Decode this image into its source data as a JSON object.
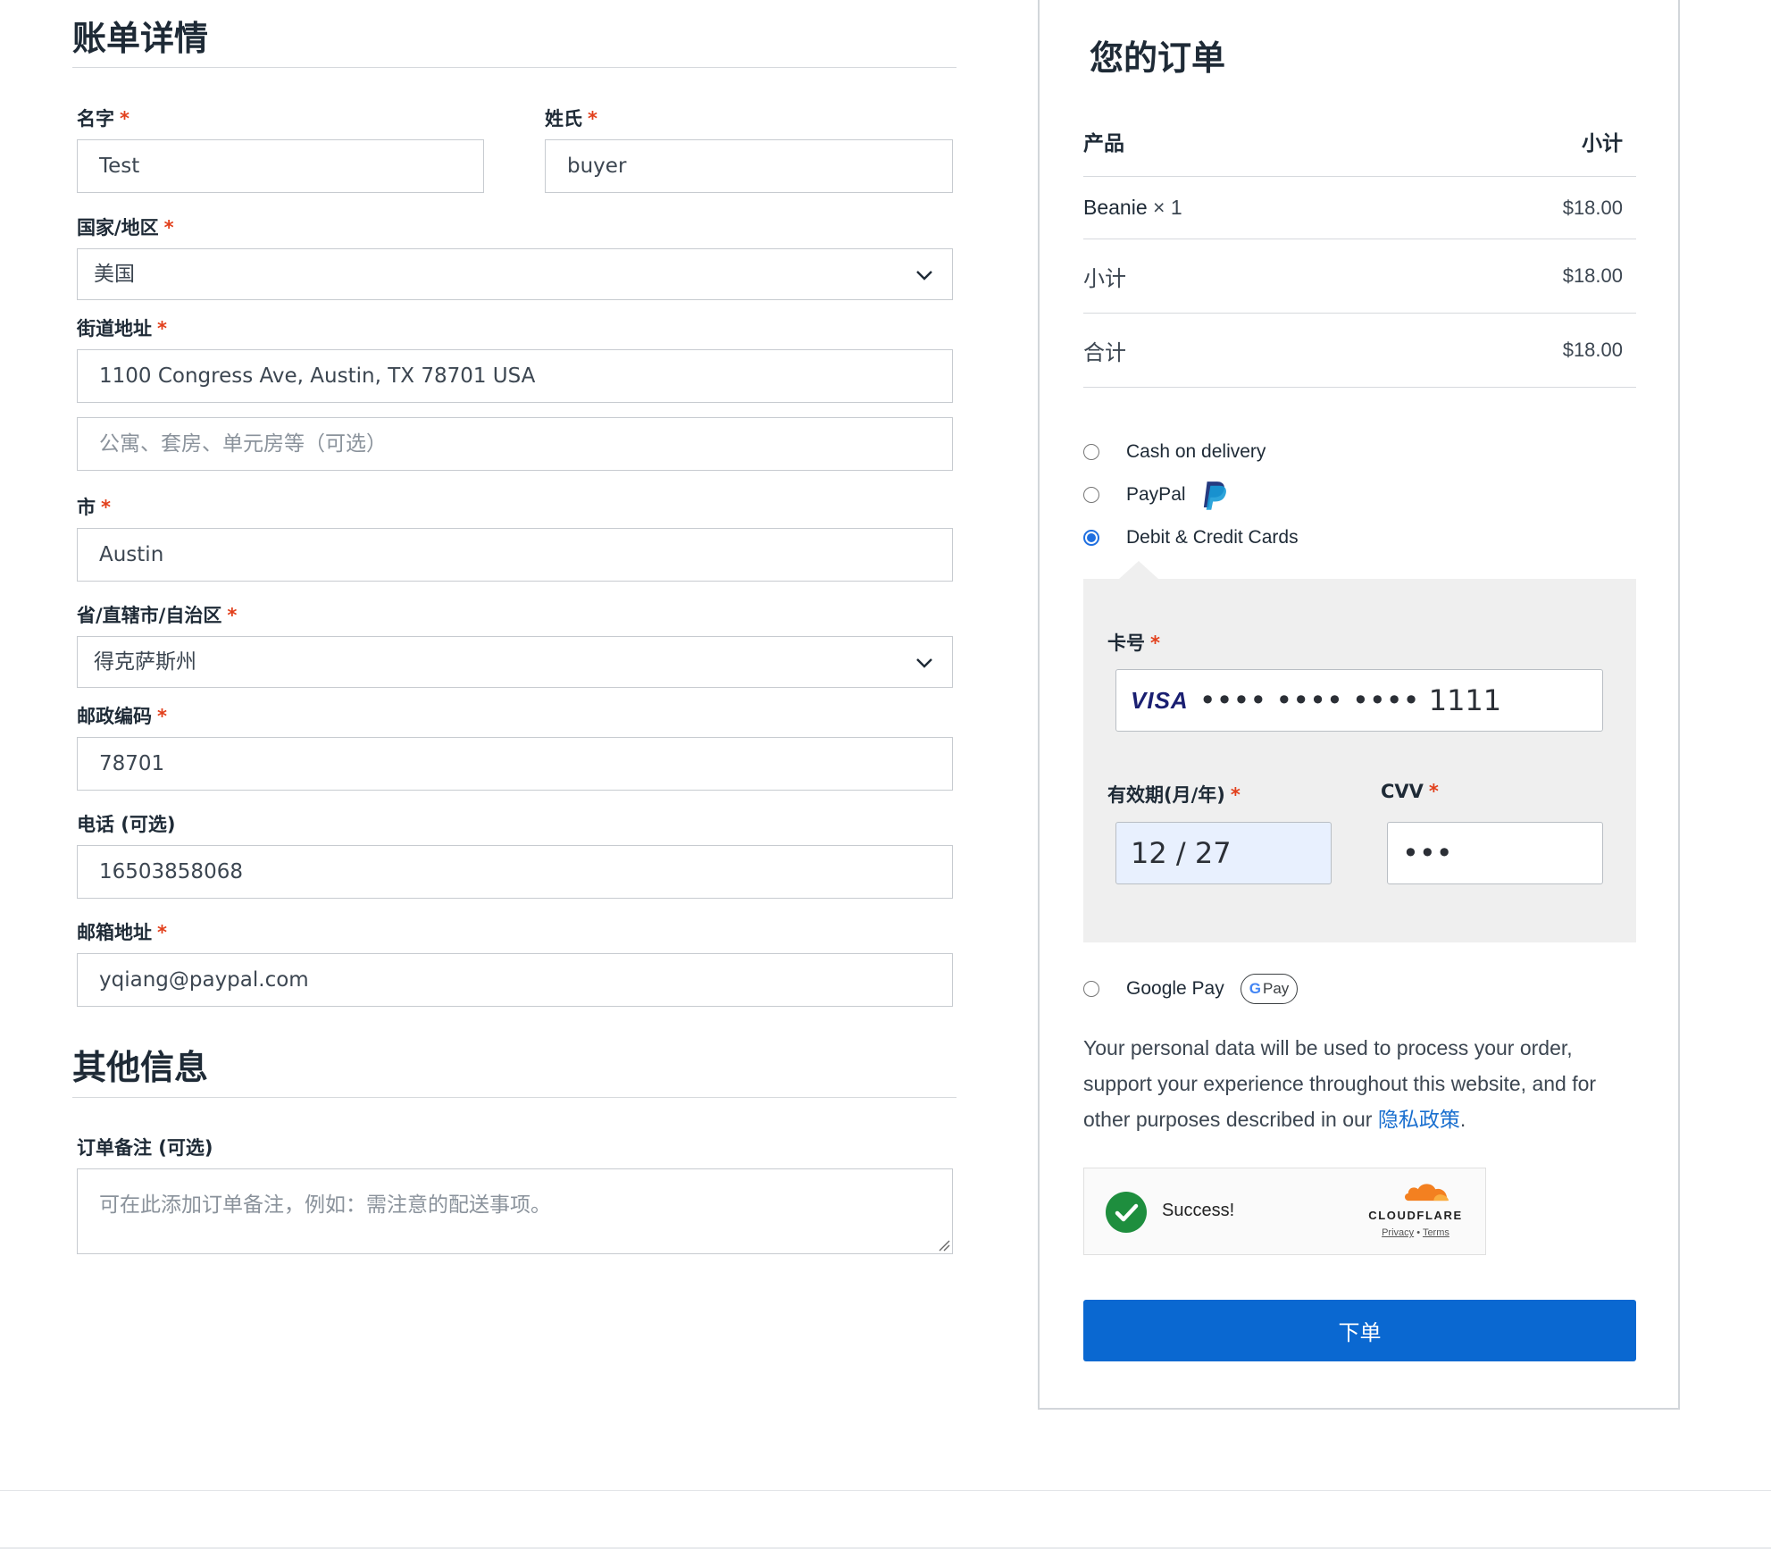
{
  "billing": {
    "title": "账单详情",
    "first_name": {
      "label": "名字",
      "value": "Test"
    },
    "last_name": {
      "label": "姓氏",
      "value": "buyer"
    },
    "country": {
      "label": "国家/地区",
      "value": "美国"
    },
    "street": {
      "label": "街道地址",
      "value": "1100 Congress Ave, Austin, TX 78701 USA",
      "placeholder2": "公寓、套房、单元房等（可选）"
    },
    "city": {
      "label": "市",
      "value": "Austin"
    },
    "state": {
      "label": "省/直辖市/自治区",
      "value": "得克萨斯州"
    },
    "postcode": {
      "label": "邮政编码",
      "value": "78701"
    },
    "phone": {
      "label": "电话 (可选)",
      "value": "16503858068"
    },
    "email": {
      "label": "邮箱地址",
      "value": "yqiang@paypal.com"
    },
    "required_mark": "*"
  },
  "additional": {
    "title": "其他信息",
    "notes": {
      "label": "订单备注 (可选)",
      "placeholder": "可在此添加订单备注，例如：需注意的配送事项。"
    }
  },
  "order": {
    "title": "您的订单",
    "col_product": "产品",
    "col_subtotal": "小计",
    "item": {
      "name": "Beanie",
      "qty": "× 1",
      "price": "$18.00"
    },
    "subtotal": {
      "label": "小计",
      "value": "$18.00"
    },
    "total": {
      "label": "合计",
      "value": "$18.00"
    }
  },
  "payment": {
    "methods": [
      {
        "label": "Cash on delivery",
        "selected": false
      },
      {
        "label": "PayPal",
        "selected": false
      },
      {
        "label": "Debit & Credit Cards",
        "selected": true
      },
      {
        "label": "Google Pay",
        "selected": false
      }
    ],
    "card": {
      "number_label": "卡号",
      "brand": "VISA",
      "number_value": "•••• •••• •••• 1111",
      "expiry_label": "有效期(月/年)",
      "expiry_value": "12 / 27",
      "cvv_label": "CVV",
      "cvv_value": "•••"
    },
    "gpay_badge": "Pay"
  },
  "privacy": {
    "text": "Your personal data will be used to process your order, support your experience throughout this website, and for other purposes described in our ",
    "link": "隐私政策",
    "end": "."
  },
  "turnstile": {
    "status": "Success!",
    "brand": "CLOUDFLARE",
    "privacy": "Privacy",
    "sep": "•",
    "terms": "Terms"
  },
  "place_order": "下单",
  "colors": {
    "accent": "#0a68d1",
    "required": "#e2401c",
    "success": "#1e8e3e",
    "panel": "#efefef"
  }
}
